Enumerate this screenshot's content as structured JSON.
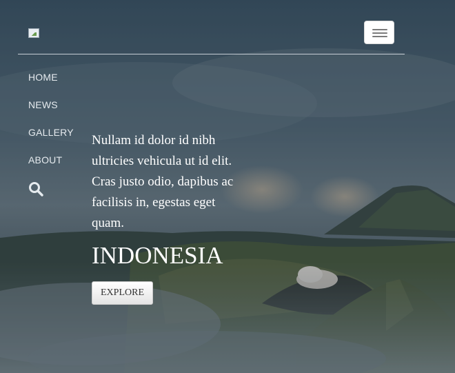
{
  "header": {
    "logo_alt": ""
  },
  "nav": {
    "items": [
      "HOME",
      "NEWS",
      "GALLERY",
      "ABOUT"
    ]
  },
  "hero": {
    "lead": "Nullam id dolor id nibh ultricies vehicula ut id elit. Cras justo odio, dapibus ac facilisis in, egestas eget quam.",
    "title": "INDONESIA",
    "button": "EXPLORE"
  },
  "icons": {
    "menu": "hamburger-menu-icon",
    "search": "search-icon",
    "logo": "broken-image-icon"
  },
  "colors": {
    "text": "#ffffff",
    "nav_text": "#e6ebef",
    "rule": "#d7dde2"
  }
}
